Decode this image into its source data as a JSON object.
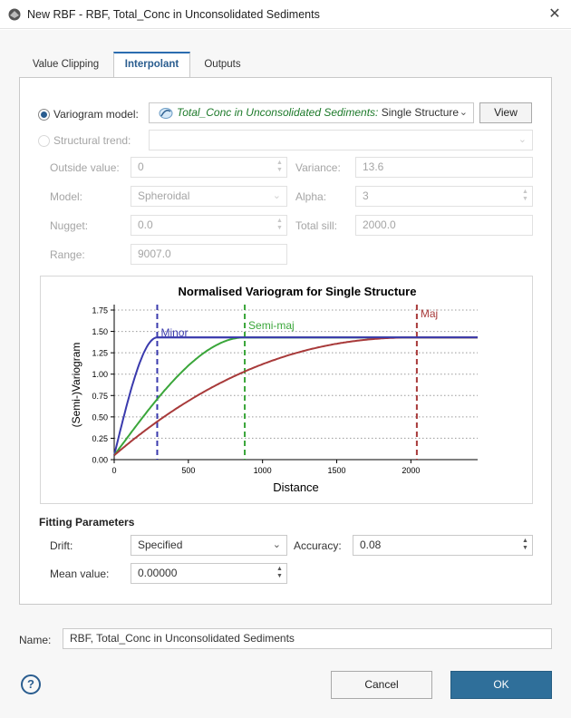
{
  "window": {
    "title": "New RBF - RBF, Total_Conc in Unconsolidated Sediments",
    "close_glyph": "✕"
  },
  "tabs": [
    {
      "label": "Value Clipping",
      "active": false
    },
    {
      "label": "Interpolant",
      "active": true
    },
    {
      "label": "Outputs",
      "active": false
    }
  ],
  "variogram": {
    "label": "Variogram model:",
    "model_italic": "Total_Conc in Unconsolidated Sediments:",
    "model_plain": " Single Structure",
    "view_button": "View",
    "structural_trend_label": "Structural trend:"
  },
  "params": {
    "outside_value": {
      "label": "Outside value:",
      "value": "0"
    },
    "variance": {
      "label": "Variance:",
      "value": "13.6"
    },
    "model": {
      "label": "Model:",
      "value": "Spheroidal"
    },
    "alpha": {
      "label": "Alpha:",
      "value": "3"
    },
    "nugget": {
      "label": "Nugget:",
      "value": "0.0"
    },
    "total_sill": {
      "label": "Total sill:",
      "value": "2000.0"
    },
    "range": {
      "label": "Range:",
      "value": "9007.0"
    }
  },
  "chart_data": {
    "type": "line",
    "title": "Normalised Variogram for Single Structure",
    "xlabel": "Distance",
    "ylabel": "(Semi-)Variogram",
    "xlim": [
      0,
      2450
    ],
    "ylim": [
      0,
      1.75
    ],
    "xticks": [
      0,
      500,
      1000,
      1500,
      2000
    ],
    "yticks": [
      0.0,
      0.25,
      0.5,
      0.75,
      1.0,
      1.25,
      1.5,
      1.75
    ],
    "sill": 1.43,
    "grid": "horizontal dotted",
    "series": [
      {
        "name": "Minor",
        "color": "#3a3aad",
        "range": 290
      },
      {
        "name": "Semi-maj",
        "color": "#3aa63a",
        "range": 880
      },
      {
        "name": "Maj",
        "color": "#a83a3a",
        "range": 2040
      }
    ]
  },
  "fitting": {
    "title": "Fitting Parameters",
    "drift": {
      "label": "Drift:",
      "value": "Specified"
    },
    "accuracy": {
      "label": "Accuracy:",
      "value": "0.08"
    },
    "mean_value": {
      "label": "Mean value:",
      "value": "0.00000"
    }
  },
  "name": {
    "label": "Name:",
    "value": "RBF, Total_Conc in Unconsolidated Sediments"
  },
  "buttons": {
    "cancel": "Cancel",
    "ok": "OK",
    "help": "?"
  }
}
